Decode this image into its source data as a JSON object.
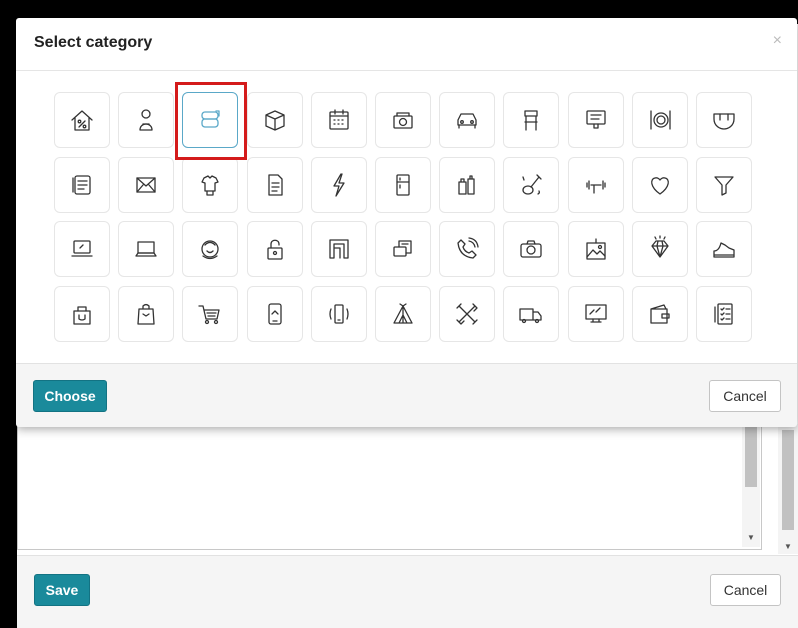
{
  "modal": {
    "title": "Select category",
    "close_glyph": "×",
    "choose_label": "Choose",
    "cancel_label": "Cancel",
    "selected_index": 2,
    "icons": [
      "house-percent-icon",
      "baby-icon",
      "towels-icon",
      "box-icon",
      "calendar-icon",
      "cash-register-icon",
      "car-icon",
      "bar-stool-icon",
      "monitor-chat-icon",
      "plate-cutlery-icon",
      "diaper-icon",
      "scroll-icon",
      "envelope-icon",
      "clothes-icon",
      "document-icon",
      "lightning-icon",
      "fridge-icon",
      "cosmetics-icon",
      "guitar-music-icon",
      "dumbbell-icon",
      "heart-icon",
      "funnel-icon",
      "laptop-icon",
      "notebook-icon",
      "face-care-icon",
      "padlock-icon",
      "frame-icon",
      "wallet-money-icon",
      "phone-call-icon",
      "camera-icon",
      "picture-icon",
      "diamond-icon",
      "sneaker-icon",
      "shopping-bag-icon",
      "gift-bag-icon",
      "cart-icon",
      "smartphone-icon",
      "vibrating-phone-icon",
      "camp-tent-icon",
      "tools-icon",
      "truck-icon",
      "tv-icon",
      "purse-icon",
      "checklist-icon"
    ]
  },
  "background_dialog": {
    "save_label": "Save",
    "cancel_label": "Cancel"
  },
  "colors": {
    "primary": "#1a8a9b",
    "selected_icon": "#5aa8c8",
    "highlight": "#d41b1b",
    "icon_stroke": "#333333"
  }
}
